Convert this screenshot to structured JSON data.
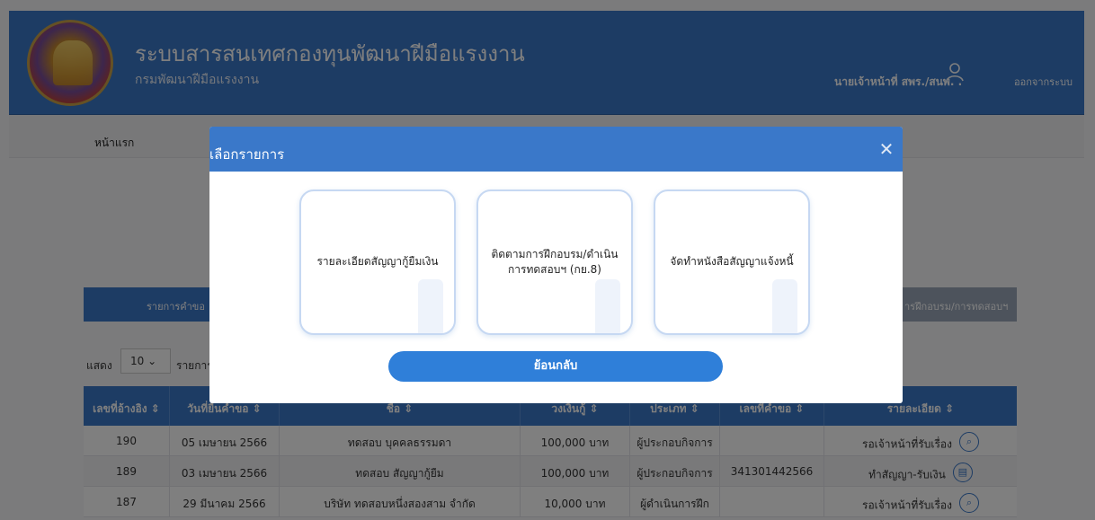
{
  "header": {
    "title": "ระบบสารสนเทศกองทุนพัฒนาฝีมือแรงงาน",
    "subtitle": "กรมพัฒนาฝีมือแรงงาน",
    "user_name": "นายเจ้าหน้าที่ สพร./สนพ. .",
    "logout_label": "ออกจากระบบ",
    "user_icon": "user-icon"
  },
  "breadcrumb": {
    "home": "หน้าแรก"
  },
  "tabs": {
    "active_label": "รายการคำขอ",
    "right_label": "ารฝึกอบรม/การทดสอบฯ"
  },
  "list_controls": {
    "show_label": "แสดง",
    "page_size": "10",
    "suffix_label": "รายการ"
  },
  "table": {
    "columns": [
      "เลขที่อ้างอิง ⇕",
      "วันที่ยื่นคำขอ ⇕",
      "ชื่อ ⇕",
      "วงเงินกู้ ⇕",
      "ประเภท ⇕",
      "เลขที่คำขอ ⇕",
      "รายละเอียด ⇕"
    ],
    "rows": [
      {
        "ref": "190",
        "date": "05 เมษายน 2566",
        "name": "ทดสอบ บุคคลธรรมดา",
        "amount": "100,000 บาท",
        "type": "ผู้ประกอบกิจการ",
        "req_no": "",
        "status": "รอเจ้าหน้าที่รับเรื่อง",
        "icon": "search-icon",
        "icon_glyph": "⌕"
      },
      {
        "ref": "189",
        "date": "03 เมษายน 2566",
        "name": "ทดสอบ สัญญากู้ยืม",
        "amount": "100,000 บาท",
        "type": "ผู้ประกอบกิจการ",
        "req_no": "341301442566",
        "status": "ทำสัญญา-รับเงิน",
        "icon": "document-icon",
        "icon_glyph": "▤"
      },
      {
        "ref": "187",
        "date": "29 มีนาคม 2566",
        "name": "บริษัท ทดสอบหนึ่งสองสาม จำกัด",
        "amount": "10,000 บาท",
        "type": "ผู้ดำเนินการฝึก",
        "req_no": "",
        "status": "รอเจ้าหน้าที่รับเรื่อง",
        "icon": "search-icon",
        "icon_glyph": "⌕"
      }
    ]
  },
  "modal": {
    "title": "เลือกรายการ",
    "close_glyph": "✕",
    "options": [
      "รายละเอียดสัญญากู้ยืมเงิน",
      "ติดตามการฝึกอบรม/ดำเนินการทดสอบฯ (กย.8)",
      "จัดทำหนังสือสัญญาแจ้งหนี้"
    ],
    "back_label": "ย้อนกลับ"
  }
}
